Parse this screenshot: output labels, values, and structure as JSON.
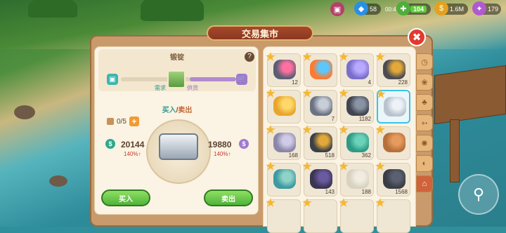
{
  "title": "交易集市",
  "hud": {
    "gems": "58",
    "timer": "00:47",
    "energy": "104",
    "coins": "1.6M",
    "orbs": "179"
  },
  "market": {
    "item_name": "锻锭",
    "demand_label": "需求",
    "supply_label": "供货",
    "demand_ratio": 0.6,
    "trade_tab_buy": "买入",
    "trade_separator": "/",
    "trade_tab_sell": "卖出",
    "quantity": "0/5",
    "buy_price": "20144",
    "buy_change": "140%↑",
    "sell_price": "19880",
    "sell_change": "140%↑",
    "buy_button": "买入",
    "sell_button": "卖出"
  },
  "grid": [
    {
      "count": "12",
      "color": "#5a5f73",
      "accent": "#ff6fa0"
    },
    {
      "count": "",
      "color": "#ff7a2e",
      "accent": "#5ac8ff"
    },
    {
      "count": "4",
      "color": "#7a6fc8",
      "accent": "#b9a9ff"
    },
    {
      "count": "228",
      "color": "#4b4b52",
      "accent": "#e2a93a"
    },
    {
      "count": "",
      "color": "#e8a52c",
      "accent": "#ffd86a"
    },
    {
      "count": "7",
      "color": "#6b7383",
      "accent": "#c8ced8"
    },
    {
      "count": "1182",
      "color": "#3f4550",
      "accent": "#8a93a3"
    },
    {
      "count": "",
      "color": "#b9c3cf",
      "accent": "#eef2f6",
      "selected": true
    },
    {
      "count": "168",
      "color": "#8a86a8",
      "accent": "#cfcbe6"
    },
    {
      "count": "518",
      "color": "#3b3f46",
      "accent": "#e2a93a"
    },
    {
      "count": "362",
      "color": "#2f9a86",
      "accent": "#6ad2b8"
    },
    {
      "count": "",
      "color": "#b5703a",
      "accent": "#e69a5c"
    },
    {
      "count": "",
      "color": "#3c9aa0",
      "accent": "#8fd2c8"
    },
    {
      "count": "143",
      "color": "#3a3550",
      "accent": "#6a5aa0"
    },
    {
      "count": "188",
      "color": "#d8d2c0",
      "accent": "#f2ece0"
    },
    {
      "count": "1568",
      "color": "#3a3d44",
      "accent": "#5a6070"
    }
  ],
  "side_tabs": [
    "clock-icon",
    "paw-icon",
    "mushroom-icon",
    "fish-icon",
    "beetle-icon",
    "shell-icon",
    "market-icon"
  ]
}
